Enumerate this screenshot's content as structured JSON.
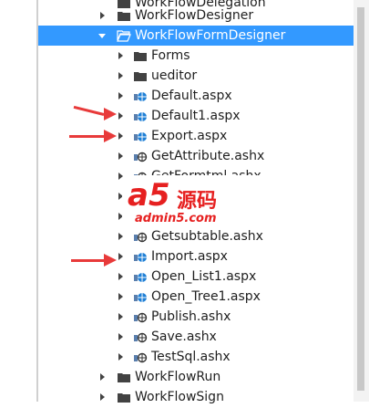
{
  "colors": {
    "selection": "#3399ff",
    "arrow": "#e83a3a",
    "watermark_red": "#e62020"
  },
  "top_partial": {
    "label": "WorkFlowDelegation",
    "icon": "folder-icon"
  },
  "items": [
    {
      "label": "WorkFlowDesigner",
      "icon": "folder-icon",
      "expander": "collapsed",
      "depth": 1
    },
    {
      "label": "WorkFlowFormDesigner",
      "icon": "folder-open-icon",
      "expander": "expanded",
      "depth": 1,
      "selected": true
    },
    {
      "label": "Forms",
      "icon": "folder-icon",
      "expander": "collapsed",
      "depth": 2
    },
    {
      "label": "ueditor",
      "icon": "folder-icon",
      "expander": "collapsed",
      "depth": 2
    },
    {
      "label": "Default.aspx",
      "icon": "aspx-file-icon",
      "expander": "collapsed",
      "depth": 2
    },
    {
      "label": "Default1.aspx",
      "icon": "aspx-file-icon",
      "expander": "collapsed",
      "depth": 2
    },
    {
      "label": "Export.aspx",
      "icon": "aspx-file-icon",
      "expander": "collapsed",
      "depth": 2
    },
    {
      "label": "GetAttribute.ashx",
      "icon": "ashx-file-icon",
      "expander": "collapsed",
      "depth": 2
    },
    {
      "label": "GetFormtml.ashx",
      "icon": "ashx-file-icon",
      "expander": "collapsed",
      "depth": 2,
      "obscured": true
    },
    {
      "label": "tml.ashx",
      "icon": "ashx-file-icon",
      "expander": "collapsed",
      "depth": 2,
      "obscured": true
    },
    {
      "label": "",
      "icon": "",
      "expander": "collapsed",
      "depth": 2,
      "obscured": true
    },
    {
      "label": "Getsubtable.ashx",
      "icon": "ashx-file-icon",
      "expander": "collapsed",
      "depth": 2
    },
    {
      "label": "Import.aspx",
      "icon": "aspx-file-icon",
      "expander": "collapsed",
      "depth": 2
    },
    {
      "label": "Open_List1.aspx",
      "icon": "aspx-file-icon",
      "expander": "collapsed",
      "depth": 2
    },
    {
      "label": "Open_Tree1.aspx",
      "icon": "aspx-file-icon",
      "expander": "collapsed",
      "depth": 2
    },
    {
      "label": "Publish.ashx",
      "icon": "ashx-file-icon",
      "expander": "collapsed",
      "depth": 2
    },
    {
      "label": "Save.ashx",
      "icon": "ashx-file-icon",
      "expander": "collapsed",
      "depth": 2
    },
    {
      "label": "TestSql.ashx",
      "icon": "ashx-file-icon",
      "expander": "collapsed",
      "depth": 2
    },
    {
      "label": "WorkFlowRun",
      "icon": "folder-icon",
      "expander": "collapsed",
      "depth": 1
    },
    {
      "label": "WorkFlowSign",
      "icon": "folder-icon",
      "expander": "collapsed",
      "depth": 1
    }
  ],
  "watermark": {
    "big": "a5",
    "cn": "源码",
    "site": "admin5.com"
  }
}
